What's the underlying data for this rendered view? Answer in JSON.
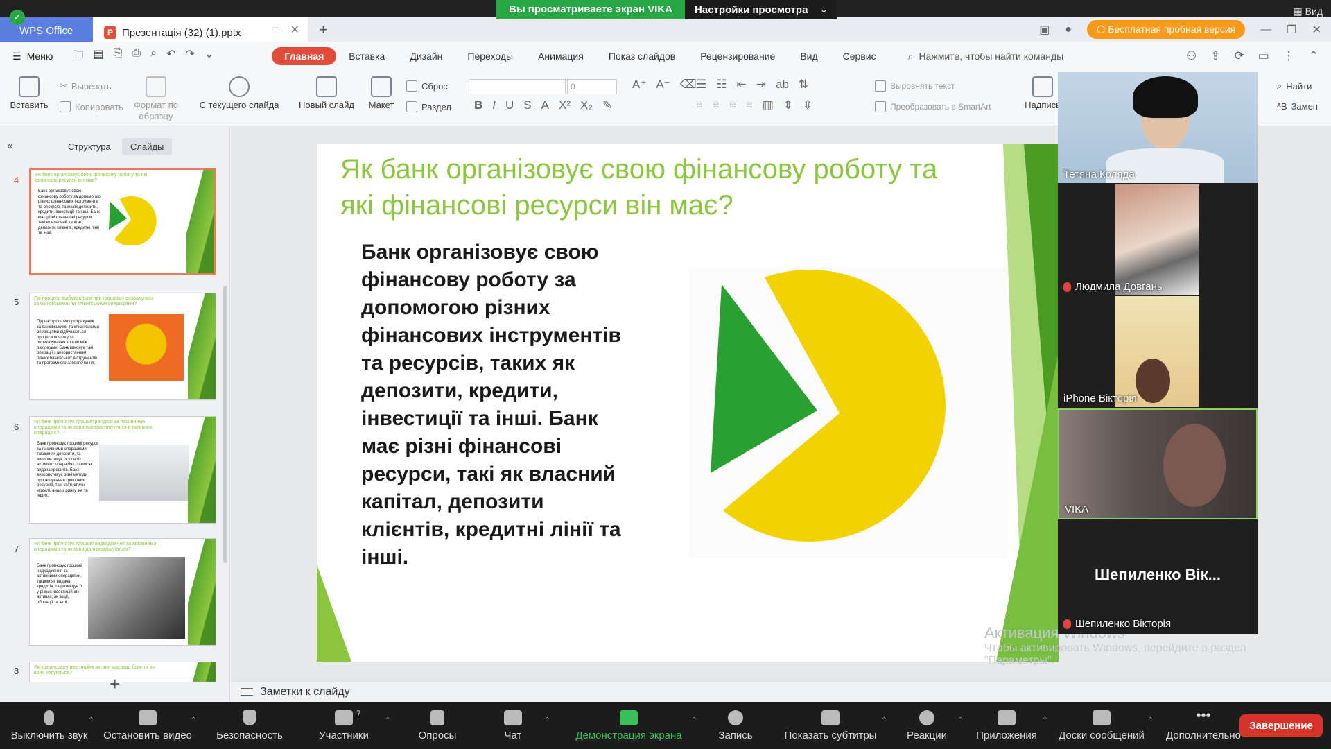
{
  "share_banner": {
    "label": "Вы просматриваете экран VIKA",
    "options": "Настройки просмотра"
  },
  "view_label": "Вид",
  "titlebar": {
    "app_tab": "WPS Office",
    "doc_tab": "Презентація (32) (1).pptx",
    "trial": "Бесплатная пробная версия"
  },
  "menu": {
    "menu_label": "Меню",
    "tabs": [
      "Главная",
      "Вставка",
      "Дизайн",
      "Переходы",
      "Анимация",
      "Показ слайдов",
      "Рецензирование",
      "Вид",
      "Сервис"
    ],
    "search": "Нажмите, чтобы найти команды"
  },
  "ribbon": {
    "paste": "Вставить",
    "cut": "Вырезать",
    "copy": "Копировать",
    "format_painter": "Формат по образцу",
    "from_current": "С текущего слайда",
    "new_slide": "Новый слайд",
    "layout": "Макет",
    "reset": "Сброс",
    "section": "Раздел",
    "font_size": "0",
    "align_text": "Выровнять текст",
    "smartart": "Преобразовать в SmartArt",
    "textbox": "Надпись",
    "find": "Найти",
    "replace": "Замен"
  },
  "left_panel": {
    "tab_outline": "Структура",
    "tab_slides": "Слайды",
    "slides": [
      {
        "num": "4",
        "title": "Як банк організовує свою фінансову роботу та які фінансові ресурси він має?",
        "body": "Банк організовує свою фінансову роботу за допомогою різних фінансових інструментів та ресурсів, таких як депозити, кредити, інвестиції та інші. Банк має різні фінансові ресурси, такі як власний капітал, депозити клієнтів, кредитні лінії та інші."
      },
      {
        "num": "5",
        "title": "Які процеси відбуваються при грошових розрахунках за банківськими та клієнтськими операціями?",
        "body": "Під час грошових розрахунків за банківськими та клієнтськими операціями відбуваються процеси початку та переказування коштів між рахунками. Банк виконує такі операції з використанням різних банківських інструментів та програмного забезпечення."
      },
      {
        "num": "6",
        "title": "Як банк прогнозує грошові ресурси за пасивними операціями та як вони використовуються в активних операціях?",
        "body": "Банк прогнозує грошові ресурси за пасивними операціями, такими як депозити, та використовує їх у своїх активних операціях, таких як видача кредитів. Банк використовує різні методи прогнозування грошових ресурсів, такі статистичні моделі, аналіз ринку же та інших."
      },
      {
        "num": "7",
        "title": "Як банк прогнозує грошові надходження за активними операціями та як вони далі розміщуються?",
        "body": "Банк прогнозує грошові надходження за активними операціями, такими як видача кредитів, та розміщує їх у різних інвестиційних активах, як акції, облігації та інші."
      },
      {
        "num": "8",
        "title": "Які фінансово-інвестиційні активи має ваш банк та як вони керуються?",
        "body": ""
      }
    ]
  },
  "slide": {
    "title": "Як банк організовує свою фінансову роботу та які фінансові ресурси він має?",
    "body": "Банк організовує свою фінансову роботу за допомогою різних фінансових інструментів та ресурсів, таких як депозити, кредити, інвестиції та інші. Банк має різні фінансові ресурси, такі як власний капітал, депозити клієнтів, кредитні лінії та інші."
  },
  "notes_label": "Заметки к слайду",
  "watermark": {
    "line1": "Активация Windows",
    "line2": "Чтобы активировать Windows, перейдите в раздел",
    "line3": "\"Параметры\".",
    "extra": "раздел"
  },
  "participants": [
    {
      "name": "Тетяна Коляда",
      "muted": false
    },
    {
      "name": "Людмила Довгань",
      "muted": true
    },
    {
      "name": "iPhone Вікторія",
      "muted": false
    },
    {
      "name": "VIKA",
      "muted": false
    },
    {
      "name": "Шепиленко Вікторія",
      "muted": true
    }
  ],
  "speaker_display": "Шепиленко Вік...",
  "zoom_toolbar": {
    "mute": "Выключить звук",
    "video": "Остановить видео",
    "security": "Безопасность",
    "participants": "Участники",
    "participant_count": "7",
    "polls": "Опросы",
    "chat": "Чат",
    "share": "Демонстрация экрана",
    "record": "Запись",
    "captions": "Показать субтитры",
    "reactions": "Реакции",
    "apps": "Приложения",
    "whiteboards": "Доски сообщений",
    "more": "Дополнительно",
    "end": "Завершение"
  }
}
